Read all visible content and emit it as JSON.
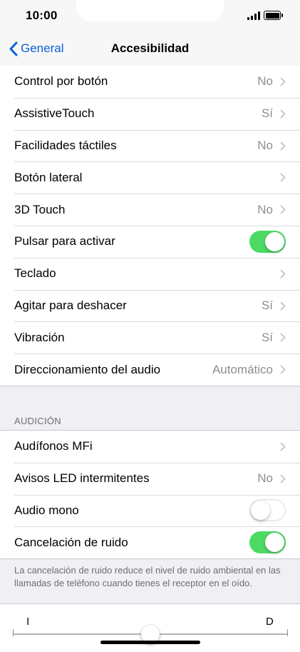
{
  "status_bar": {
    "time": "10:00"
  },
  "nav": {
    "back_label": "General",
    "title": "Accesibilidad"
  },
  "main_list": [
    {
      "label": "Control por botón",
      "value": "No",
      "control": "chevron"
    },
    {
      "label": "AssistiveTouch",
      "value": "Sí",
      "control": "chevron"
    },
    {
      "label": "Facilidades táctiles",
      "value": "No",
      "control": "chevron"
    },
    {
      "label": "Botón lateral",
      "value": "",
      "control": "chevron"
    },
    {
      "label": "3D Touch",
      "value": "No",
      "control": "chevron"
    },
    {
      "label": "Pulsar para activar",
      "control": "switch",
      "on": true
    },
    {
      "label": "Teclado",
      "value": "",
      "control": "chevron"
    },
    {
      "label": "Agitar para deshacer",
      "value": "Sí",
      "control": "chevron"
    },
    {
      "label": "Vibración",
      "value": "Sí",
      "control": "chevron"
    },
    {
      "label": "Direccionamiento del audio",
      "value": "Automático",
      "control": "chevron"
    }
  ],
  "hearing_section": {
    "header": "AUDICIÓN",
    "items": [
      {
        "label": "Audífonos MFi",
        "value": "",
        "control": "chevron"
      },
      {
        "label": "Avisos LED intermitentes",
        "value": "No",
        "control": "chevron"
      },
      {
        "label": "Audio mono",
        "control": "switch",
        "on": false
      },
      {
        "label": "Cancelación de ruido",
        "control": "switch",
        "on": true
      }
    ],
    "footer": "La cancelación de ruido reduce el nivel de ruido ambiental en las llamadas de teléfono cuando tienes el receptor en el oído."
  },
  "balance_slider": {
    "left_label": "I",
    "right_label": "D",
    "value": 0.5
  },
  "colors": {
    "accent": "#0a60d8",
    "switch_on": "#4cd964",
    "secondary_text": "#8e8e93",
    "background": "#efeff4"
  }
}
